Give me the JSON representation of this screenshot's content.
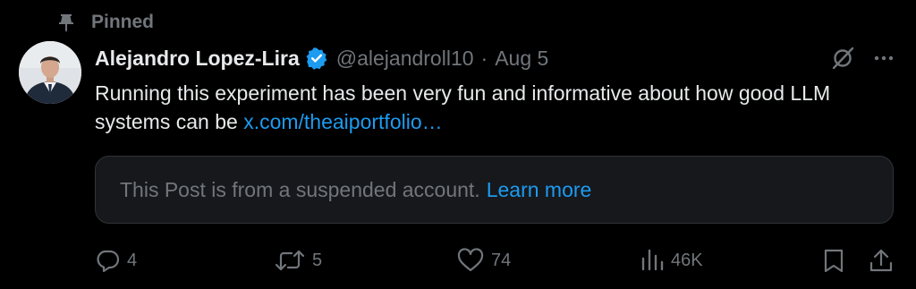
{
  "pinned": {
    "label": "Pinned",
    "icon": "pin-icon"
  },
  "author": {
    "name": "Alejandro Lopez-Lira",
    "handle": "@alejandroll10",
    "separator": "·",
    "date": "Aug 5",
    "verified": true,
    "avatar": "avatar-photo"
  },
  "tweet": {
    "text": "Running this experiment has been very fun and informative about how good LLM systems can be ",
    "link": "x.com/theaiportfolio…"
  },
  "quoted_card": {
    "text": "This Post is from a suspended account.",
    "link_label": "Learn more"
  },
  "actions": {
    "replies": "4",
    "reposts": "5",
    "likes": "74",
    "views": "46K"
  },
  "colors": {
    "background": "#000000",
    "primary_text": "#e7e9ea",
    "secondary_text": "#71767b",
    "accent": "#1d9bf0",
    "card_bg": "#16181c",
    "card_border": "#2f3336"
  }
}
